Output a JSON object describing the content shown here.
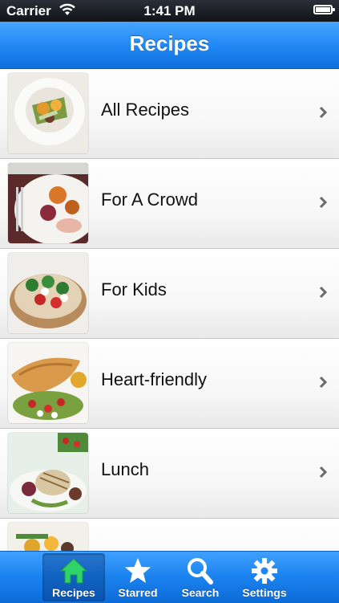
{
  "status_bar": {
    "carrier": "Carrier",
    "time": "1:41 PM"
  },
  "nav": {
    "title": "Recipes"
  },
  "categories": [
    {
      "label": "All Recipes"
    },
    {
      "label": "For A Crowd"
    },
    {
      "label": "For Kids"
    },
    {
      "label": "Heart-friendly"
    },
    {
      "label": "Lunch"
    },
    {
      "label": ""
    }
  ],
  "tabs": [
    {
      "label": "Recipes",
      "icon": "house-icon",
      "active": true
    },
    {
      "label": "Starred",
      "icon": "star-icon",
      "active": false
    },
    {
      "label": "Search",
      "icon": "magnifier-icon",
      "active": false
    },
    {
      "label": "Settings",
      "icon": "gear-icon",
      "active": false
    }
  ],
  "colors": {
    "nav_blue": "#1f86f2",
    "active_tab_icon": "#2fd36a"
  }
}
